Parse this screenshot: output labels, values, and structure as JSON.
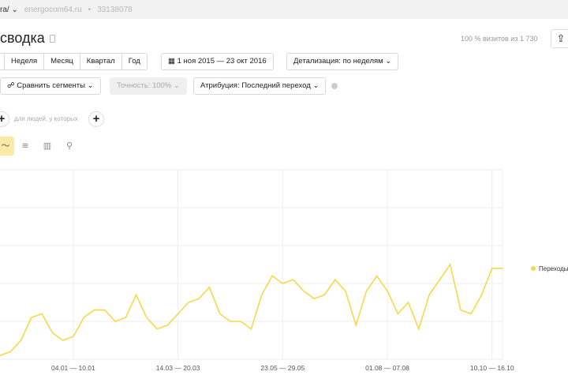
{
  "topbar": {
    "counter_name": "ra/",
    "site": "energocom64.ru",
    "separator": "•",
    "counter_id": "33138078"
  },
  "page": {
    "title": "сводка",
    "visits_info": "100 % визитов из 1 730",
    "export_icon": "upload-icon"
  },
  "period": {
    "items": [
      "",
      "Неделя",
      "Месяц",
      "Квартал",
      "Год"
    ],
    "date_range": "1 ноя 2015 — 23 окт 2016",
    "detail": "Детализация: по неделям"
  },
  "filters": {
    "compare": "Сравнить сегменты",
    "accuracy": "Точность: 100%",
    "attribution": "Атрибуция: Последний переход"
  },
  "conditions": {
    "text": "для людей, у которых"
  },
  "views": [
    {
      "icon": "line-chart-icon",
      "active": true
    },
    {
      "icon": "area-chart-icon"
    },
    {
      "icon": "bar-chart-icon"
    },
    {
      "icon": "map-pin-icon"
    }
  ],
  "chart_data": {
    "type": "line",
    "xlabel": "",
    "ylabel": "",
    "tick_labels": [
      "04.01 — 10.01",
      "14.03 — 20.03",
      "23.05 — 29.05",
      "01.08 — 07.08",
      "10.10 — 16.10"
    ],
    "ylim": [
      0,
      50
    ],
    "grid": true,
    "legend_placement": "right",
    "color": "#f8d84a",
    "series": [
      {
        "name": "Переходы",
        "values": [
          1,
          2,
          5,
          11,
          12,
          7,
          5,
          6,
          11,
          13,
          13,
          10,
          11,
          17,
          11,
          8,
          9,
          12,
          15,
          16,
          19,
          12,
          10,
          10,
          8,
          17,
          22,
          20,
          21,
          18,
          16,
          17,
          21,
          18,
          9,
          18,
          22,
          18,
          12,
          15,
          8,
          17,
          21,
          25,
          13,
          12,
          17,
          24,
          24
        ]
      }
    ]
  }
}
